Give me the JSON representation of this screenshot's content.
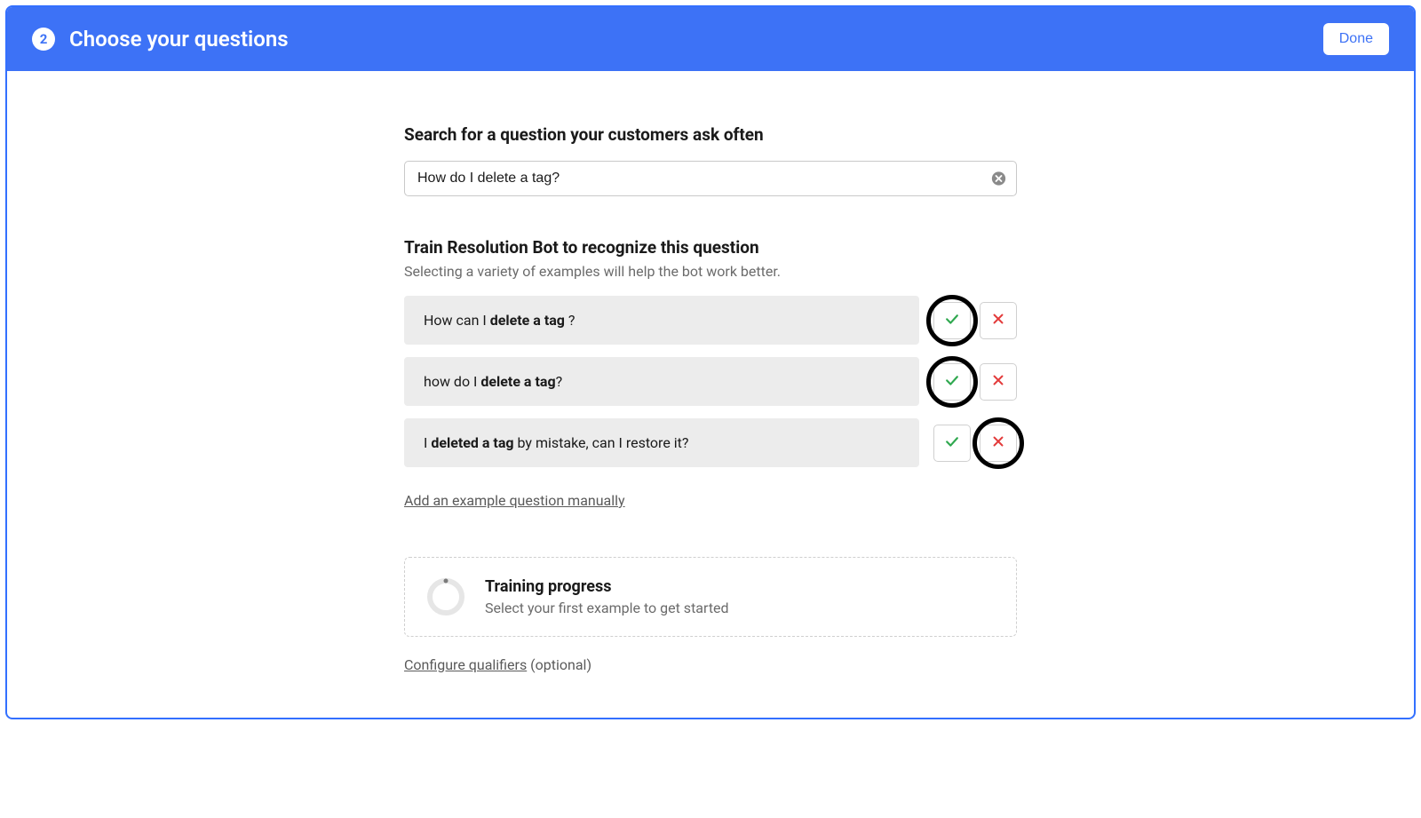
{
  "header": {
    "step": "2",
    "title": "Choose your questions",
    "done_label": "Done"
  },
  "search": {
    "label": "Search for a question your customers ask often",
    "value": "How do I delete a tag?",
    "clear_icon": "clear-circle-icon"
  },
  "train": {
    "title": "Train Resolution Bot to recognize this question",
    "subtitle": "Selecting a variety of examples will help the bot work better."
  },
  "examples": [
    {
      "prefix": "How can I ",
      "bold": "delete a tag",
      "suffix": " ?",
      "highlight": "accept"
    },
    {
      "prefix": "how do I ",
      "bold": "delete a tag",
      "suffix": "?",
      "highlight": "accept"
    },
    {
      "prefix": "I ",
      "bold": "deleted a tag",
      "suffix": " by mistake, can I restore it?",
      "highlight": "reject"
    }
  ],
  "add_example_label": "Add an example question manually",
  "progress": {
    "title": "Training progress",
    "subtitle": "Select your first example to get started"
  },
  "configure": {
    "link": "Configure qualifiers",
    "suffix": " (optional)"
  },
  "icons": {
    "accept": "check-icon",
    "reject": "x-icon"
  }
}
